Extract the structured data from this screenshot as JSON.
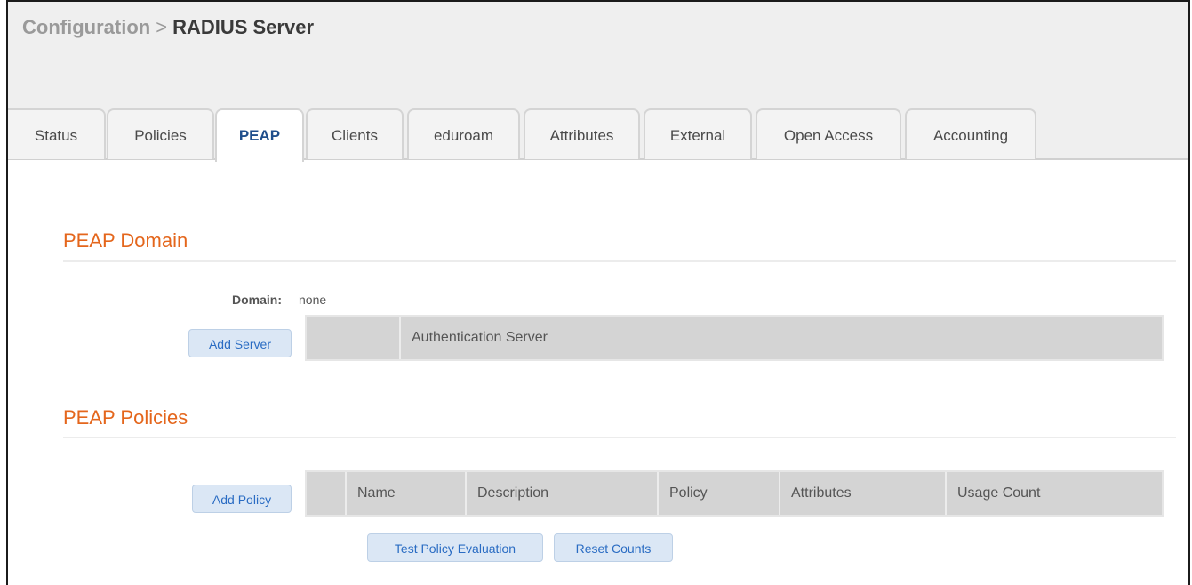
{
  "breadcrumb": {
    "parent": "Configuration",
    "separator": ">",
    "current": "RADIUS Server"
  },
  "tabs": [
    {
      "label": "Status",
      "active": false
    },
    {
      "label": "Policies",
      "active": false
    },
    {
      "label": "PEAP",
      "active": true
    },
    {
      "label": "Clients",
      "active": false
    },
    {
      "label": "eduroam",
      "active": false
    },
    {
      "label": "Attributes",
      "active": false
    },
    {
      "label": "External",
      "active": false
    },
    {
      "label": "Open Access",
      "active": false
    },
    {
      "label": "Accounting",
      "active": false
    }
  ],
  "peap_domain": {
    "title": "PEAP Domain",
    "domain_label": "Domain:",
    "domain_value": "none",
    "add_server_label": "Add Server",
    "columns": [
      "",
      "Authentication Server"
    ]
  },
  "peap_policies": {
    "title": "PEAP Policies",
    "add_policy_label": "Add Policy",
    "columns": [
      "",
      "Name",
      "Description",
      "Policy",
      "Attributes",
      "Usage Count"
    ],
    "test_policy_label": "Test Policy Evaluation",
    "reset_counts_label": "Reset Counts"
  },
  "colors": {
    "section_title": "#e4661c",
    "active_tab": "#1f4e8c",
    "button_text": "#2a6cc3",
    "button_bg": "#dbe7f5"
  }
}
